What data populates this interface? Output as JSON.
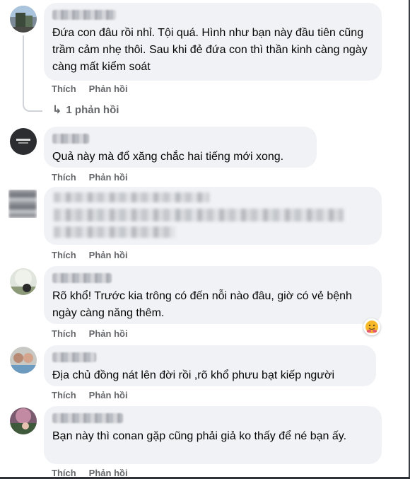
{
  "comments": [
    {
      "text": "Đứa con đâu rồi nhỉ. Tội quá. Hình như bạn này đầu tiên cũng trầm cảm nhẹ thôi. Sau khi đẻ đứa con thì thần kinh càng ngày càng mất kiểm soát"
    },
    {
      "text": "Quả này mà đổ xăng chắc hai tiếng mới xong."
    },
    {
      "text": ""
    },
    {
      "text": "Rõ khổ! Trước kia trông có đến nỗi nào đâu, giờ có vẻ bệnh ngày càng năng thêm."
    },
    {
      "text": "Địa chủ đồng nát lên đời rồi ,rõ khổ phưu bạt kiếp người"
    },
    {
      "text": "Bạn này thì conan gặp cũng phải giả ko thấy để né bạn ấy."
    }
  ],
  "actions": {
    "like": "Thích",
    "reply": "Phản hồi"
  },
  "replies": {
    "count_label": "1 phản hồi"
  },
  "reaction": {
    "icon": "hug-emoji-icon",
    "color": "#f7b928"
  }
}
